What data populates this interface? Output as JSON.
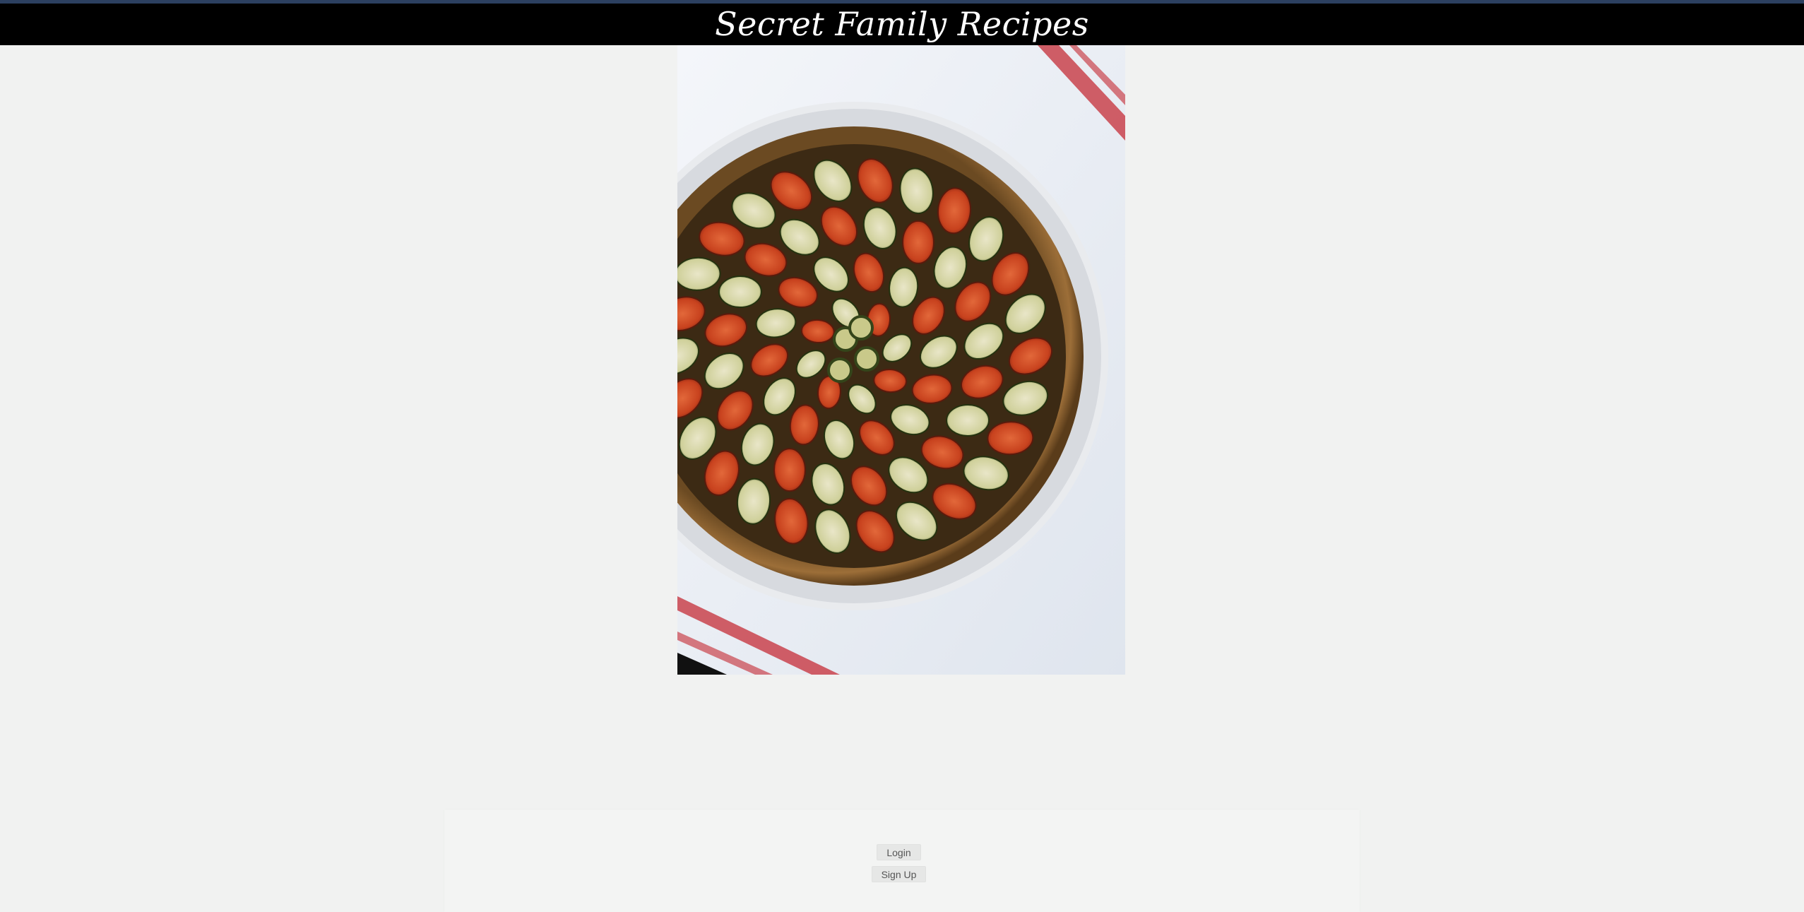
{
  "header": {
    "title": "Secret Family Recipes"
  },
  "hero": {
    "alt": "Vegetable tart with tomato and zucchini slices in a white fluted dish on a striped towel"
  },
  "auth": {
    "login_label": "Login",
    "signup_label": "Sign Up"
  },
  "colors": {
    "header_bg": "#000000",
    "topline": "#2c4060",
    "page_bg": "#f1f2f1"
  }
}
